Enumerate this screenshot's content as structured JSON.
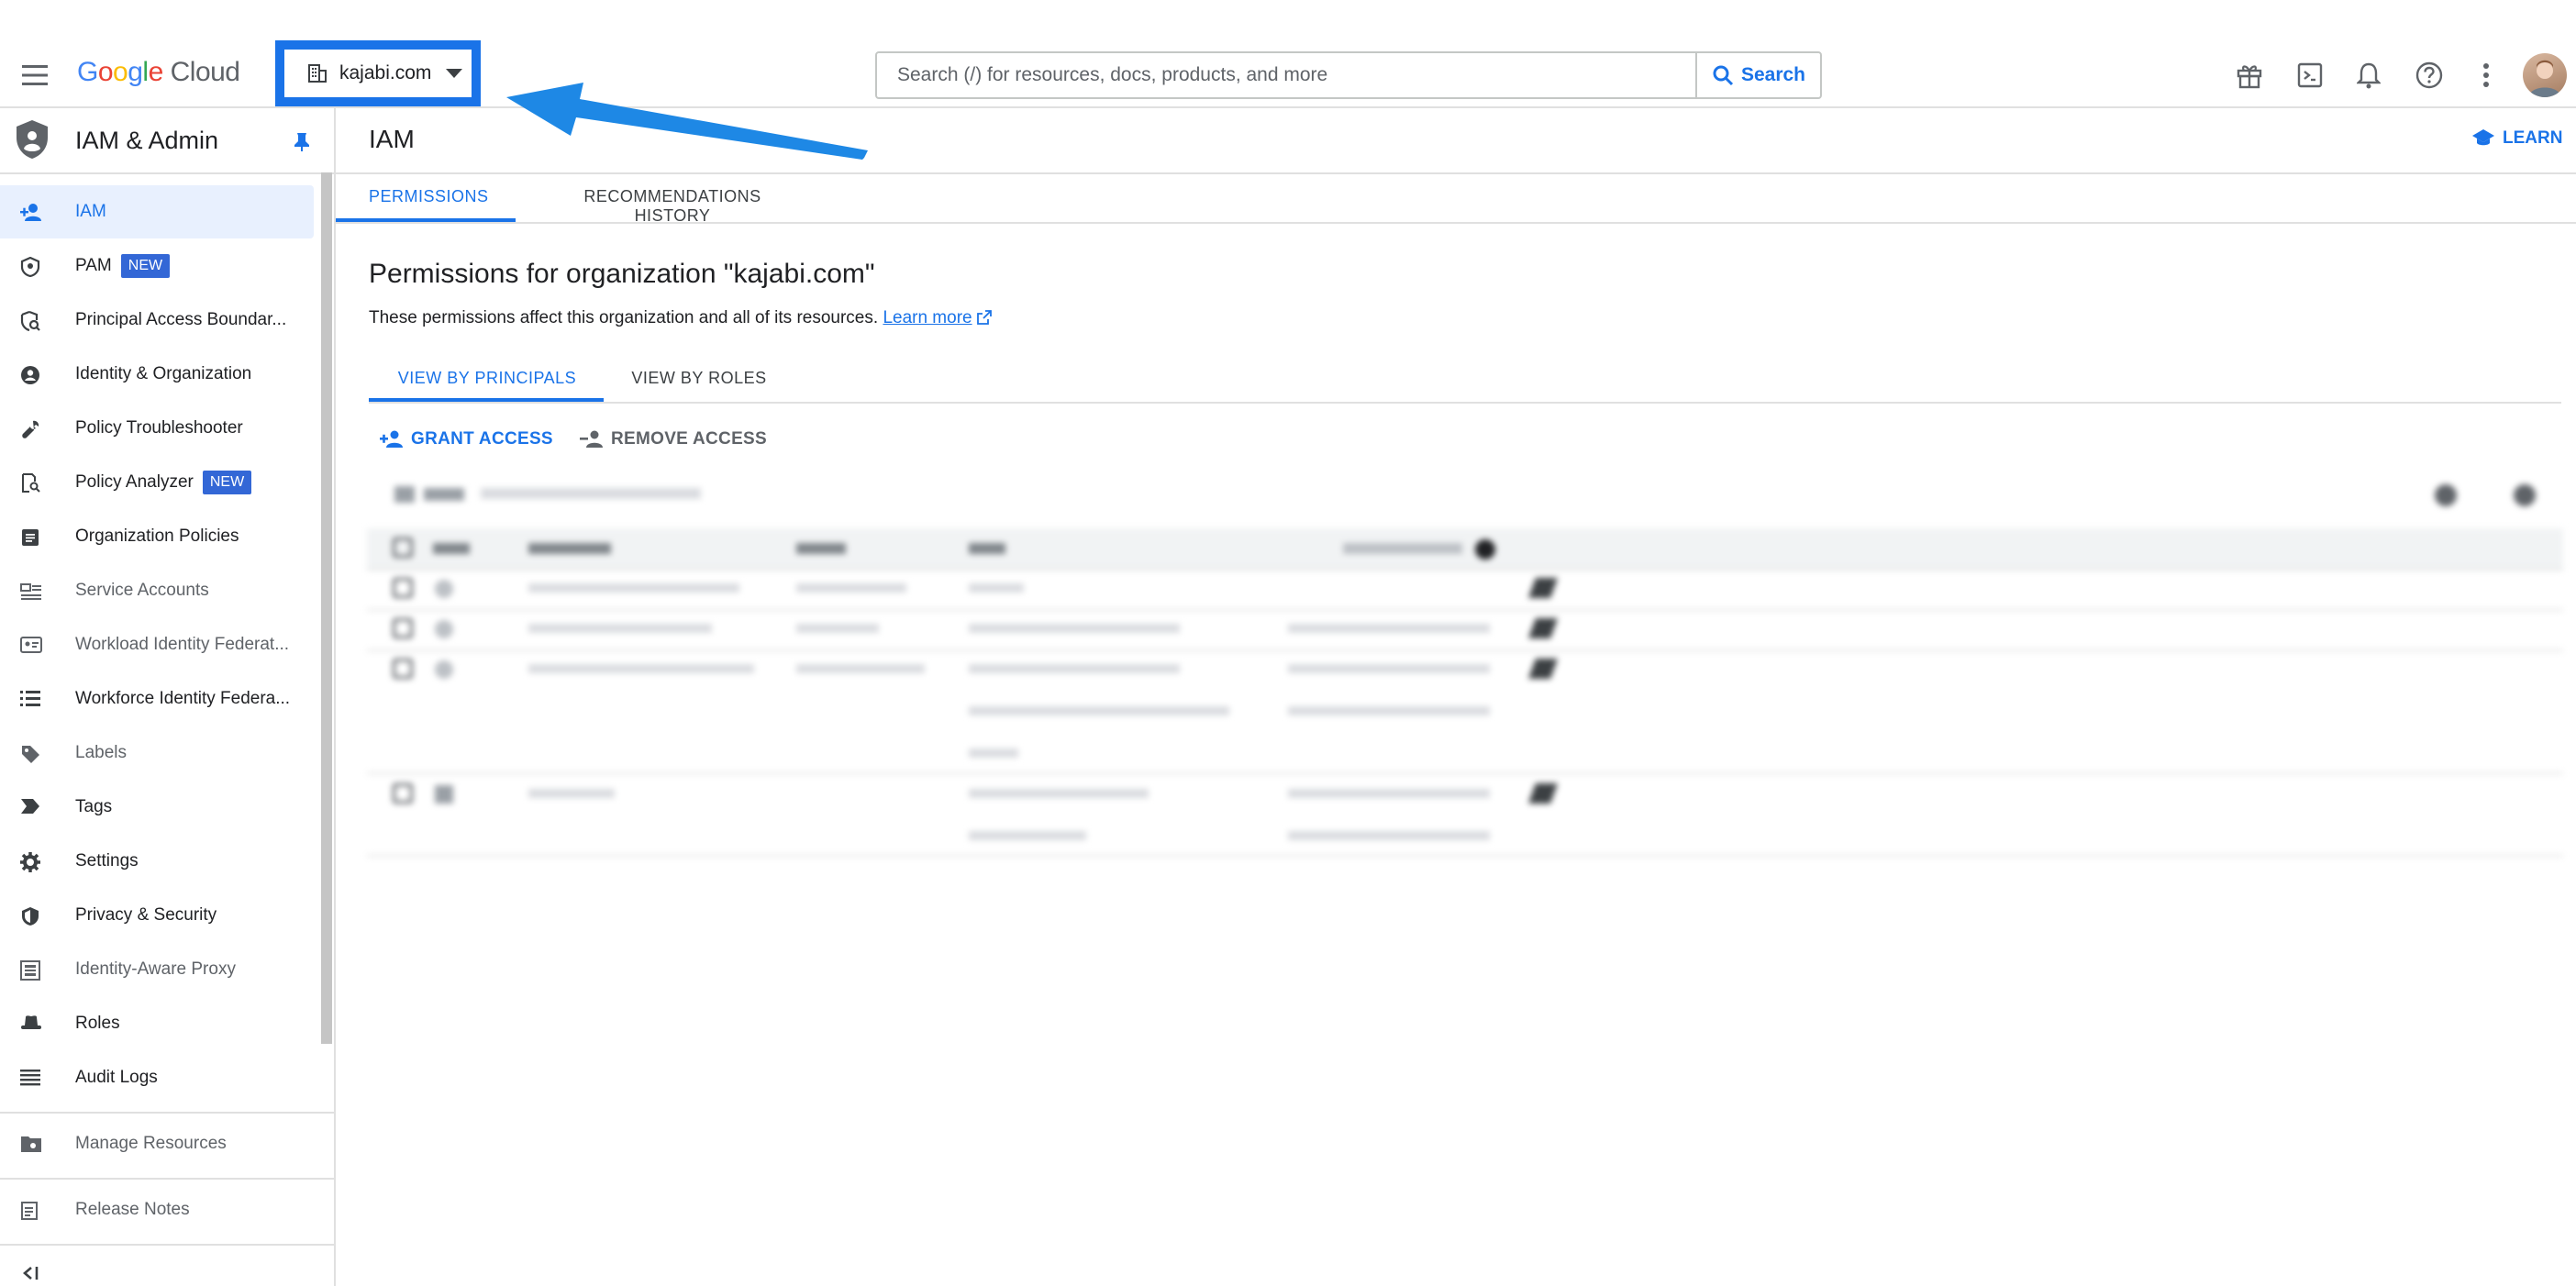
{
  "header": {
    "logo": {
      "google": "Google",
      "cloud": "Cloud"
    },
    "project": "kajabi.com",
    "search": {
      "placeholder": "Search (/) for resources, docs, products, and more",
      "button": "Search"
    },
    "icons": [
      "gift-icon",
      "terminal-icon",
      "bell-icon",
      "help-icon",
      "more-vert-icon"
    ]
  },
  "sidebar": {
    "title": "IAM & Admin",
    "items": [
      {
        "label": "IAM",
        "icon": "person-add-icon",
        "active": true
      },
      {
        "label": "PAM",
        "badge": "NEW",
        "icon": "shield-account-icon"
      },
      {
        "label": "Principal Access Boundar...",
        "icon": "policy-search-icon"
      },
      {
        "label": "Identity & Organization",
        "icon": "account-circle-icon"
      },
      {
        "label": "Policy Troubleshooter",
        "icon": "wrench-icon"
      },
      {
        "label": "Policy Analyzer",
        "badge": "NEW",
        "icon": "document-search-icon"
      },
      {
        "label": "Organization Policies",
        "icon": "article-icon"
      },
      {
        "label": "Service Accounts",
        "icon": "service-account-icon"
      },
      {
        "label": "Workload Identity Federat...",
        "icon": "badge-card-icon"
      },
      {
        "label": "Workforce Identity Federa...",
        "icon": "list-icon"
      },
      {
        "label": "Labels",
        "icon": "tag-icon"
      },
      {
        "label": "Tags",
        "icon": "label-arrow-icon"
      },
      {
        "label": "Settings",
        "icon": "gear-icon"
      },
      {
        "label": "Privacy & Security",
        "icon": "shield-icon"
      },
      {
        "label": "Identity-Aware Proxy",
        "icon": "proxy-icon"
      },
      {
        "label": "Roles",
        "icon": "hat-icon"
      },
      {
        "label": "Audit Logs",
        "icon": "lines-icon"
      }
    ],
    "manage_resources": "Manage Resources",
    "release_notes": "Release Notes"
  },
  "main": {
    "title": "IAM",
    "learn": "LEARN",
    "tabs": [
      "PERMISSIONS",
      "RECOMMENDATIONS HISTORY"
    ],
    "heading": "Permissions for organization \"kajabi.com\"",
    "description": "These permissions affect this organization and all of its resources.",
    "learn_more": "Learn more",
    "subtabs": [
      "VIEW BY PRINCIPALS",
      "VIEW BY ROLES"
    ],
    "actions": {
      "grant": "GRANT ACCESS",
      "remove": "REMOVE ACCESS"
    }
  },
  "colors": {
    "accent": "#1a73e8",
    "highlight_box": "#1a73e8",
    "arrow": "#1e88e5"
  }
}
